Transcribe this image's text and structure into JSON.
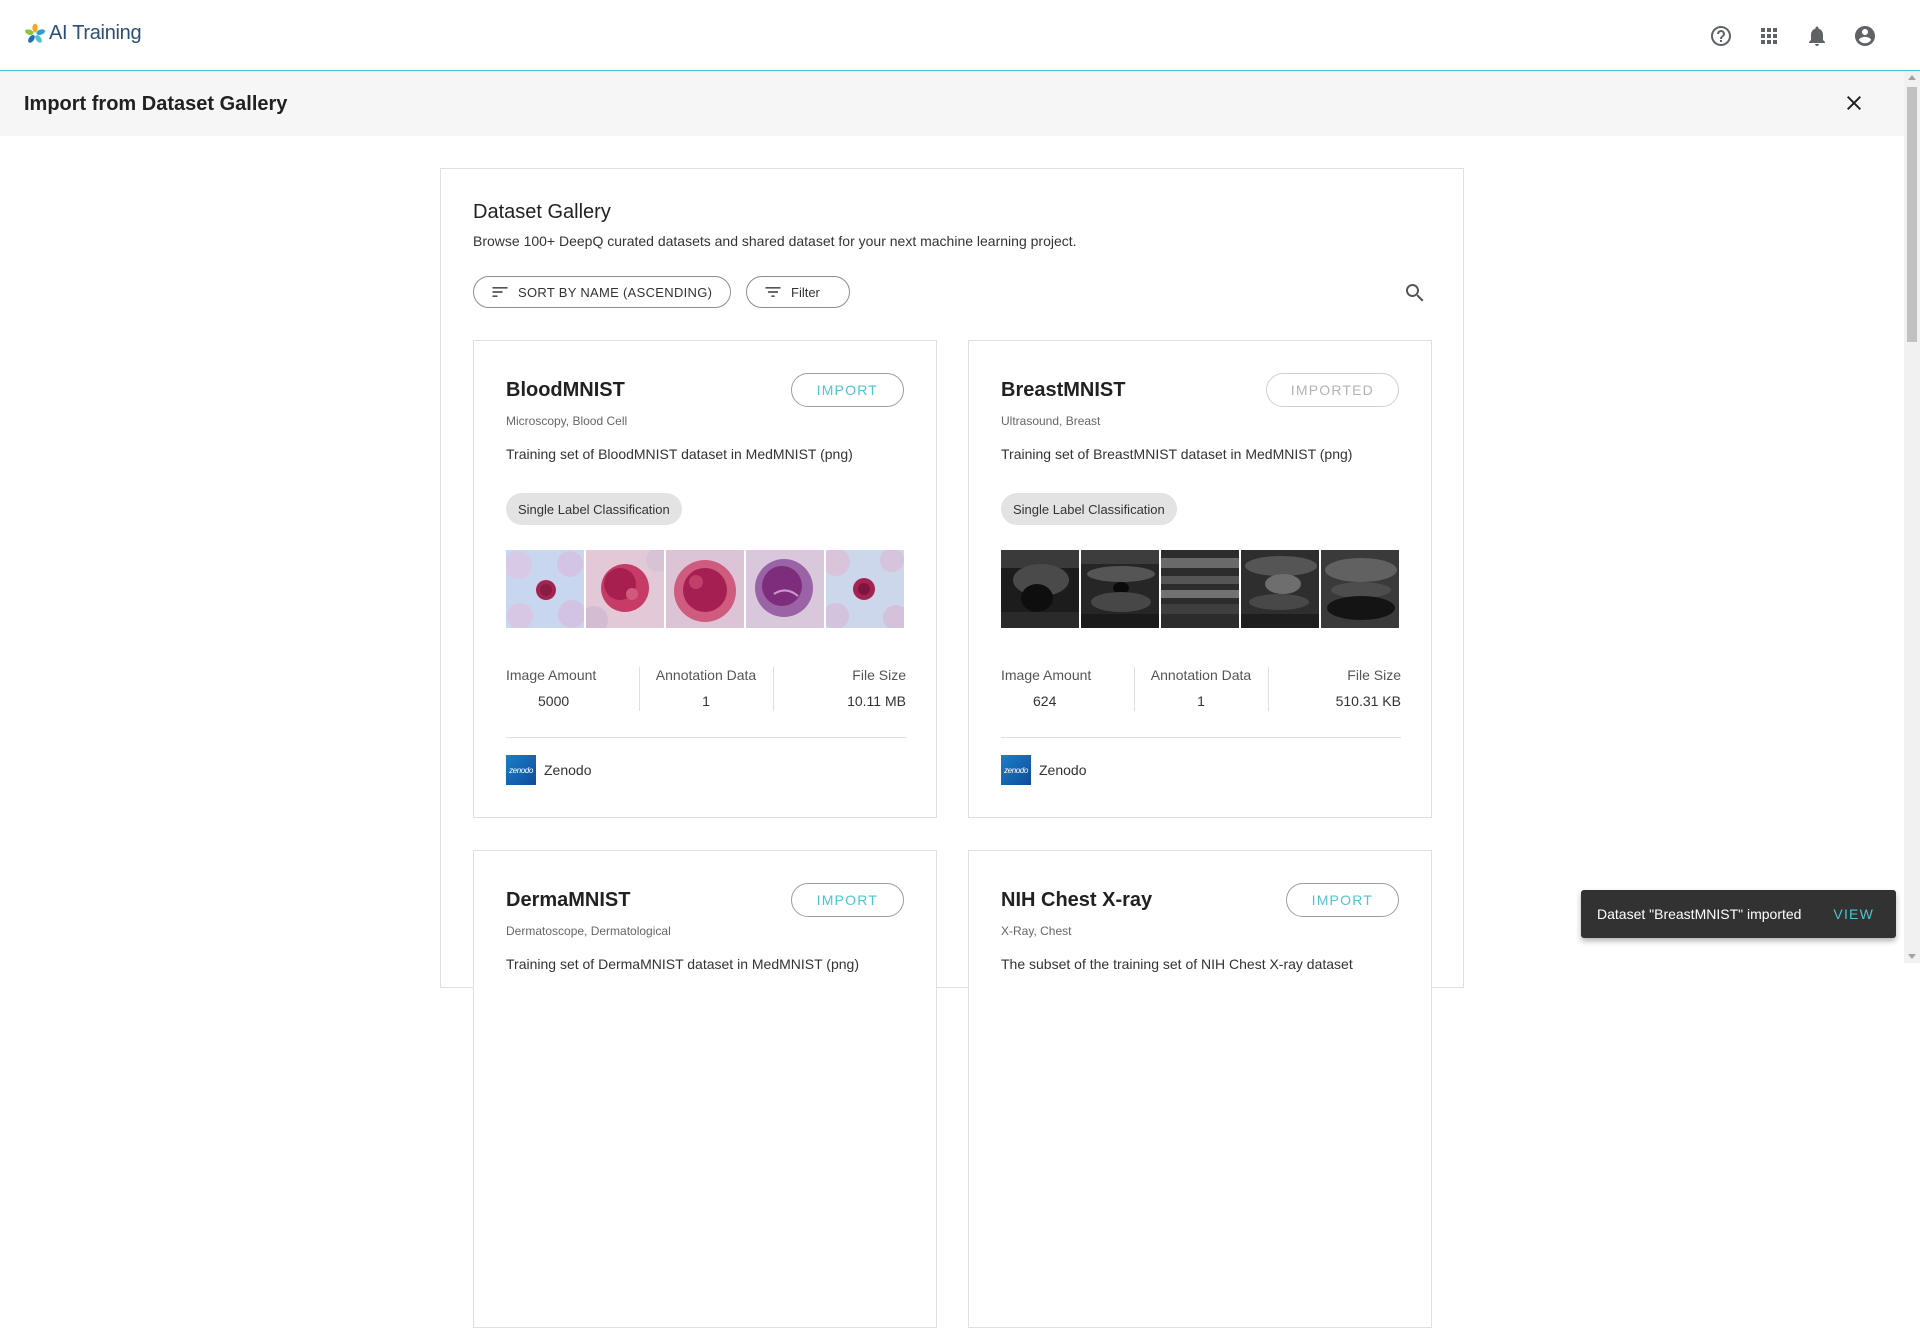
{
  "app": {
    "name": "AI Training"
  },
  "header": {
    "icons": [
      "help-icon",
      "apps-grid-icon",
      "notifications-icon",
      "account-icon"
    ]
  },
  "subheader": {
    "title": "Import from Dataset Gallery",
    "close_icon": "close-icon"
  },
  "gallery": {
    "title": "Dataset Gallery",
    "subtitle": "Browse 100+ DeepQ curated datasets and shared dataset for your next machine learning project.",
    "sort_label": "SORT BY NAME (ASCENDING)",
    "filter_label": "Filter",
    "stat_labels": {
      "images": "Image Amount",
      "annotations": "Annotation Data",
      "size": "File Size"
    }
  },
  "cards": [
    {
      "name": "BloodMNIST",
      "tags": "Microscopy, Blood Cell",
      "description": "Training set of BloodMNIST dataset in MedMNIST (png)",
      "button": "IMPORT",
      "chip": "Single Label Classification",
      "image_amount": "5000",
      "annotation_data": "1",
      "file_size": "10.11 MB",
      "source_logo": "zenodo",
      "source": "Zenodo"
    },
    {
      "name": "BreastMNIST",
      "tags": "Ultrasound, Breast",
      "description": "Training set of BreastMNIST dataset in MedMNIST (png)",
      "button": "IMPORTED",
      "chip": "Single Label Classification",
      "image_amount": "624",
      "annotation_data": "1",
      "file_size": "510.31 KB",
      "source_logo": "zenodo",
      "source": "Zenodo"
    },
    {
      "name": "DermaMNIST",
      "tags": "Dermatoscope, Dermatological",
      "description": "Training set of DermaMNIST dataset in MedMNIST (png)",
      "button": "IMPORT"
    },
    {
      "name": "NIH Chest X-ray",
      "tags": "X-Ray, Chest",
      "description": "The subset of the training set of NIH Chest X-ray dataset",
      "button": "IMPORT"
    }
  ],
  "snackbar": {
    "message": "Dataset \"BreastMNIST\" imported",
    "action": "VIEW"
  },
  "colors": {
    "accent": "#4fc3d6",
    "brand_text": "#2d4e73",
    "snackbar_bg": "#323232"
  }
}
